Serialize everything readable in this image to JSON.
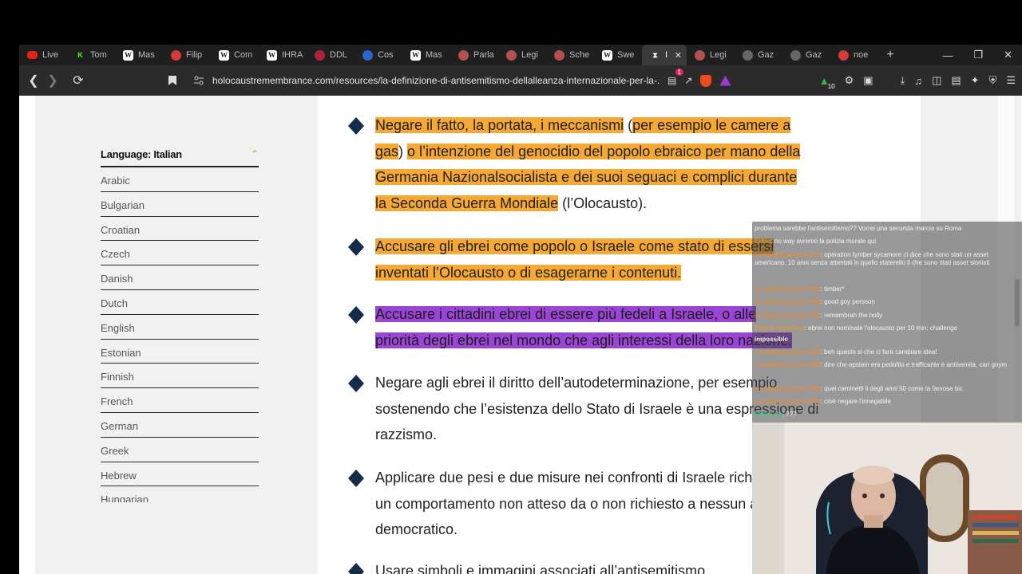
{
  "browser": {
    "tabs": [
      {
        "label": "Live",
        "icon": "youtube-icon",
        "color": "#e62117"
      },
      {
        "label": "Tom",
        "icon": "kick-icon",
        "color": "#53fc18"
      },
      {
        "label": "Mas",
        "icon": "wikipedia-icon",
        "color": "#555555"
      },
      {
        "label": "Filip",
        "icon": "site-icon",
        "color": "#d33a3a"
      },
      {
        "label": "Com",
        "icon": "wikipedia-icon",
        "color": "#555555"
      },
      {
        "label": "IHRA",
        "icon": "wikipedia-icon",
        "color": "#555555"
      },
      {
        "label": "DDL",
        "icon": "site-icon",
        "color": "#b0203a"
      },
      {
        "label": "Cos",
        "icon": "site-icon",
        "color": "#2a66c9"
      },
      {
        "label": "Mas",
        "icon": "wikipedia-icon",
        "color": "#555555"
      },
      {
        "label": "Parla",
        "icon": "site-icon",
        "color": "#b64f4f"
      },
      {
        "label": "Legi",
        "icon": "site-icon",
        "color": "#b64f4f"
      },
      {
        "label": "Sche",
        "icon": "site-icon",
        "color": "#b64f4f"
      },
      {
        "label": "Swe",
        "icon": "wikipedia-icon",
        "color": "#555555"
      },
      {
        "label": "I",
        "icon": "ihra-icon",
        "color": "#ffffff",
        "active": true
      },
      {
        "label": "Legi",
        "icon": "site-icon",
        "color": "#b64f4f"
      },
      {
        "label": "Gaz",
        "icon": "site-icon",
        "color": "#666666"
      },
      {
        "label": "Gaz",
        "icon": "site-icon",
        "color": "#666666"
      },
      {
        "label": "noe",
        "icon": "site-icon",
        "color": "#d33a3a"
      }
    ],
    "url": "holocaustremembrance.com/resources/la-definizione-di-antisemitismo-dellalleanza-internazionale-per-la-...",
    "brave_badge": "1",
    "extension_badge": "10"
  },
  "sidebar": {
    "language_label": "Language: Italian",
    "languages": [
      "Arabic",
      "Bulgarian",
      "Croatian",
      "Czech",
      "Danish",
      "Dutch",
      "English",
      "Estonian",
      "Finnish",
      "French",
      "German",
      "Greek",
      "Hebrew",
      "Hungarian"
    ]
  },
  "content": {
    "p1": {
      "s1": "Negare il fatto, la portata, i meccanismi",
      "s2": " (",
      "s3": "per esempio le camere a",
      "s4": "gas",
      "s5": ") ",
      "s6": "o l’intenzione del genocidio del popolo ebraico per mano della",
      "s7": "Germania Nazionalsocialista e dei suoi seguaci e complici durante",
      "s8": "la Seconda Guerra Mondiale",
      "s9": " (l’Olocausto)."
    },
    "p2": {
      "s1": "Accusare gli ebrei come popolo o Israele come stato di essersi",
      "s2": "inventati l’Olocausto o di esagerarne i contenuti."
    },
    "p3": {
      "s1": "Accusare i cittadini ebrei di essere più fedeli a Israele, o alle",
      "s2": "priorità degli ebrei nel mondo che agli interessi della loro nazione."
    },
    "p4": "Negare agli ebrei il diritto dell’autodeterminazione, per esempio sostenendo che l’esistenza dello Stato di Israele è una espressione di razzismo.",
    "p5": "Applicare due pesi e due misure nei confronti di Israele richiedendo un comportamento non atteso da o non richiesto a nessun altro stato democratico.",
    "p6": "Usare simboli e immagini associati all’antisemitismo"
  },
  "chat": {
    "messages": [
      {
        "user": "",
        "text": "problema sarebbe l'antisemitismo?? Vorrei una seconda marcia su Roma",
        "color": "#ee8a2f"
      },
      {
        "user": "Ebbio",
        "text": ": no way avremo la polizia morale qui",
        "color": "#e79a2a"
      },
      {
        "user": "incelpapistgroyper1488",
        "text": ": operation fymber sycamore ci dice che sono stati un asset americano. 10 anni senza attentati in quello staterello li che sono stati asset sionisti",
        "color": "#ee8a2f"
      },
      {
        "user": "incelpapistgroyper1488",
        "text": ": timber*",
        "color": "#ee8a2f"
      },
      {
        "user": "incelpapistgroyper1488",
        "text": ": good goy persson",
        "color": "#ee8a2f"
      },
      {
        "user": "incelpapistgroyper1488",
        "text": ": remembrah the holly",
        "color": "#ee8a2f"
      },
      {
        "user": "PietraFreddaCiud",
        "text": ": ebrei non nominate l'olocausto per 10 min: challenge",
        "color": "#e79a2a"
      },
      {
        "user": "",
        "text": "impossible",
        "color": "#ffffff"
      },
      {
        "user": "incelpapistgroyper1488",
        "text": ": beh questo si che ci fara cambiare idea!",
        "color": "#ee8a2f"
      },
      {
        "user": "incelpapistgroyper1488",
        "text": ": dire che epstein era pedofilo e trafficante è antisemita, cari goym",
        "color": "#ee8a2f"
      },
      {
        "user": "incelpapistgroyper1488",
        "text": ": quei caminetti li degli anni 50 come la famosa bic",
        "color": "#ee8a2f"
      },
      {
        "user": "incelpapistgroyper1488",
        "text": ": cioè negare l'innegabile",
        "color": "#ee8a2f"
      },
      {
        "user": "flamm_ita",
        "text": ": ???",
        "color": "#2fcf7a"
      }
    ]
  }
}
